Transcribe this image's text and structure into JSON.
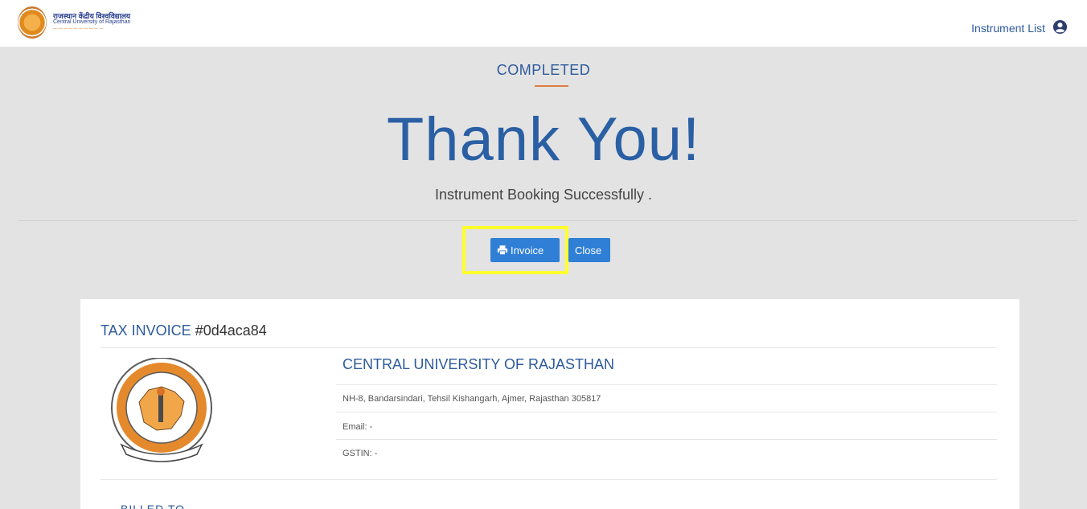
{
  "header": {
    "logo_hindi": "राजस्थान केंद्रीय विश्वविद्यालय",
    "logo_english": "Central University of Rajasthan",
    "nav_link": "Instrument List",
    "user_icon": "user-circle-icon"
  },
  "status": {
    "label": "COMPLETED",
    "title": "Thank You!",
    "message": "Instrument Booking Successfully ."
  },
  "actions": {
    "invoice_label": "Invoice",
    "invoice_icon": "print-icon",
    "close_label": "Close"
  },
  "invoice": {
    "title_label": "TAX INVOICE",
    "id": "#0d4aca84",
    "org_name": "CENTRAL UNIVERSITY OF RAJASTHAN",
    "address": "NH-8, Bandarsindari, Tehsil Kishangarh, Ajmer, Rajasthan 305817",
    "email": "Email: -",
    "gstin": "GSTIN: -",
    "billed_to": "BILLED TO"
  },
  "colors": {
    "accent": "#2a5fa4",
    "button": "#2f7fd6",
    "highlight": "#ffff2a",
    "underline": "#e07c3e"
  }
}
